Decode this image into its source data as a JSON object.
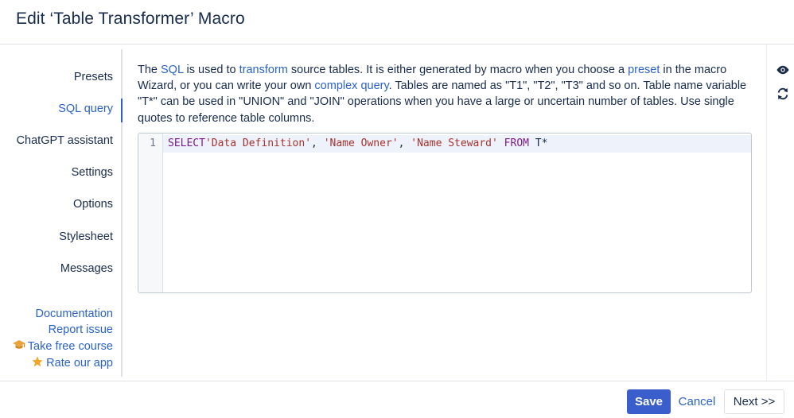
{
  "header": {
    "title": "Edit ‘Table Transformer’ Macro"
  },
  "sidebar": {
    "items": [
      {
        "label": "Presets"
      },
      {
        "label": "SQL query"
      },
      {
        "label": "ChatGPT assistant"
      },
      {
        "label": "Settings"
      },
      {
        "label": "Options"
      },
      {
        "label": "Stylesheet"
      },
      {
        "label": "Messages"
      }
    ],
    "active_index": 1,
    "links": [
      {
        "label": "Documentation",
        "icon": ""
      },
      {
        "label": "Report issue",
        "icon": ""
      },
      {
        "label": "Take free course",
        "icon": "graduation-cap-icon"
      },
      {
        "label": "Rate our app",
        "icon": "star-icon"
      }
    ]
  },
  "description": {
    "t1": "The ",
    "sql_link": "SQL",
    "t2": " is used to ",
    "transform_link": "transform",
    "t3": " source tables. It is either generated by macro when you choose a ",
    "preset_link": "preset",
    "t4": " in the macro Wizard, or you can write your own ",
    "complex_link": "complex query",
    "t5": ". Tables are named as \"T1\", \"T2\", \"T3\" and so on. Table name variable \"T*\" can be used in \"UNION\" and \"JOIN\" operations when you have a large or uncertain number of tables. Use single quotes to reference table columns."
  },
  "editor": {
    "line_number": "1",
    "tokens": {
      "k1": "SELECT",
      "s1": "'Data Definition'",
      "c1": ", ",
      "s2": "'Name Owner'",
      "c2": ", ",
      "s3": "'Name Steward'",
      "c3": " ",
      "k2": "FROM",
      "c4": " T*"
    }
  },
  "rail": {
    "preview_icon": "eye-icon",
    "refresh_icon": "refresh-icon"
  },
  "footer": {
    "save": "Save",
    "cancel": "Cancel",
    "next": "Next >>"
  },
  "colors": {
    "accent": "#2a62c9",
    "primary_button": "#3a5fcd",
    "keyword": "#7a1b8c",
    "string": "#a8312c"
  }
}
